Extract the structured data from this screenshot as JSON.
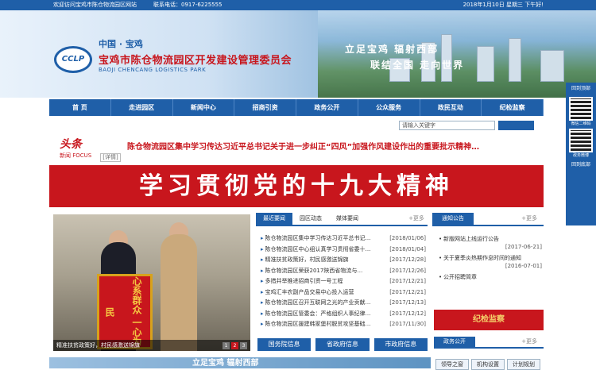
{
  "topbar": {
    "welcome": "欢迎访问宝鸡市陈仓物流园区网站",
    "phone": "联系电话：0917-6225555",
    "date": "2018年1月10日 星期三 下午好!"
  },
  "header": {
    "logo_text": "CCLP",
    "subtitle": "中国 · 宝鸡",
    "title": "宝鸡市陈仓物流园区开发建设管理委员会",
    "english": "BAOJI CHENCANG LOGISTICS PARK",
    "slogan1": "立足宝鸡  辐射西部",
    "slogan2": "联结全国  走向世界"
  },
  "nav": [
    "首 页",
    "走进园区",
    "新闻中心",
    "招商引资",
    "政务公开",
    "公众服务",
    "政民互动",
    "纪检监察"
  ],
  "search": {
    "placeholder": "请输入关键字"
  },
  "headline": {
    "logo_big": "头条",
    "logo_small": "新闻 FOCUS",
    "tag": "[详情]",
    "text": "陈仓物流园区集中学习传达习近平总书记关于进一步纠正“四风”加强作风建设作出的重要批示精神…"
  },
  "banner": "学习贯彻党的十九大精神",
  "photo": {
    "caption": "精准扶贫政策好，村民感激送锦旗",
    "flag_text": "心系群众 一心为民",
    "pages": [
      "1",
      "2",
      "3"
    ]
  },
  "news_tabs": [
    "最近要闻",
    "园区动态",
    "媒体要闻"
  ],
  "more": "+更多",
  "news": [
    {
      "title": "陈仓物流园区集中学习传达习近平总书记…",
      "date": "[2018/01/06]"
    },
    {
      "title": "陈仓物流园区中心组认真学习贯彻省委十…",
      "date": "[2018/01/04]"
    },
    {
      "title": "精准扶贫政策好，村民感激送锦旗",
      "date": "[2017/12/28]"
    },
    {
      "title": "陈仓物流园区荣获2017陕西省物流与…",
      "date": "[2017/12/26]"
    },
    {
      "title": "多措并举推进招商引资一号工程",
      "date": "[2017/12/21]"
    },
    {
      "title": "宝鸡汇丰农副产品交易中心投入运营",
      "date": "[2017/12/21]"
    },
    {
      "title": "陈仓物流园区召开互联网之光的产业贡献…",
      "date": "[2017/12/13]"
    },
    {
      "title": "陈仓物流园区管委会：严格组织人事纪律…",
      "date": "[2017/12/12]"
    },
    {
      "title": "陈仓物流园区援建韩家堡村脱贫攻坚基础…",
      "date": "[2017/11/30]"
    }
  ],
  "quick_links": [
    "国务院信息",
    "省政府信息",
    "市政府信息"
  ],
  "notice": {
    "title": "通知公告",
    "items": [
      {
        "title": "新版网站上线运行公告",
        "date": "[2017-06-21]"
      },
      {
        "title": "关于夏季炎热期作息时间的通知",
        "date": "[2016-07-01]"
      },
      {
        "title": "公开招聘简章",
        "date": ""
      }
    ]
  },
  "jjjc": "纪检监察",
  "affairs": {
    "title": "政务公开",
    "items": [
      "领导之窗",
      "机构设置",
      "计划规划"
    ]
  },
  "bottom_strip": "立足宝鸡  辐射西部",
  "float": {
    "top_btn": "回到顶部",
    "wechat": "微信二维码",
    "service": "政务微博",
    "bottom_btn": "回到底部"
  },
  "colors": {
    "primary": "#1f5fa8",
    "accent": "#c8161d",
    "gold": "#f5d06a"
  }
}
